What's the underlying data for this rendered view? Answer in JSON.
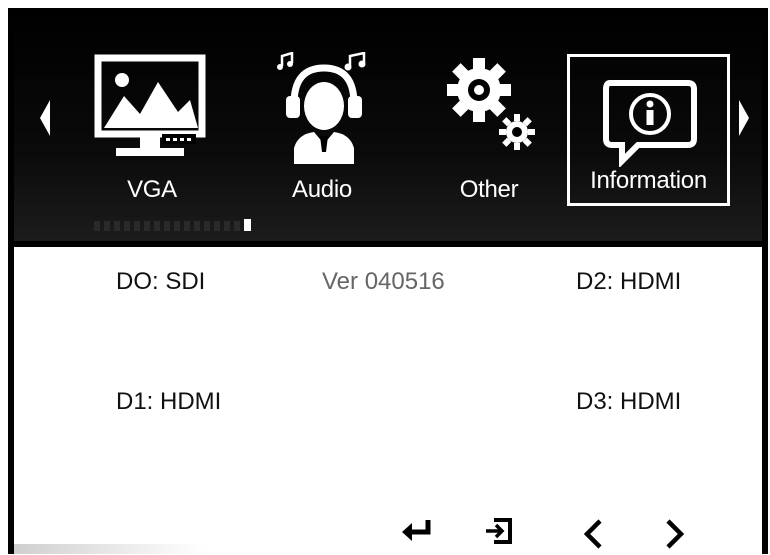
{
  "menu": {
    "items": [
      {
        "label": "VGA",
        "icon": "vga-image-icon"
      },
      {
        "label": "Audio",
        "icon": "audio-headphones-icon"
      },
      {
        "label": "Other",
        "icon": "gears-icon"
      },
      {
        "label": "Information",
        "icon": "info-icon",
        "selected": true
      }
    ],
    "page_count": 16,
    "active_page": 16
  },
  "info": {
    "d0": "DO: SDI",
    "version": "Ver 040516",
    "d2": "D2: HDMI",
    "d1": "D1: HDMI",
    "d3": "D3: HDMI"
  },
  "nav": {
    "buttons": [
      "enter-icon",
      "exit-icon",
      "left-icon",
      "right-icon"
    ]
  },
  "colors": {
    "menu_background": "#000000",
    "text_primary": "#111111",
    "version_text": "#666666",
    "highlight_border": "#ffffff"
  }
}
